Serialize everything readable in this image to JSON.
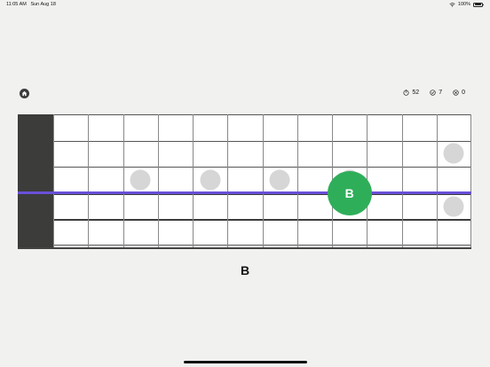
{
  "status_bar": {
    "time": "11:05 AM",
    "date": "Sun Aug 18",
    "battery": "100%",
    "wifi_icon": "wifi-icon",
    "battery_icon": "battery-icon"
  },
  "toolbar": {
    "home_icon": "house-icon"
  },
  "stats": {
    "timer_value": "52",
    "correct_value": "7",
    "wrong_value": "0"
  },
  "fretboard": {
    "fret_count": 12,
    "string_count": 6,
    "marker_frets": [
      3,
      5,
      7,
      9,
      12
    ],
    "highlighted_string": 3,
    "highlight_color": "#6a4fd8"
  },
  "target": {
    "label": "B",
    "fret": 9,
    "color": "#2fae5a"
  },
  "question": {
    "note": "B"
  }
}
